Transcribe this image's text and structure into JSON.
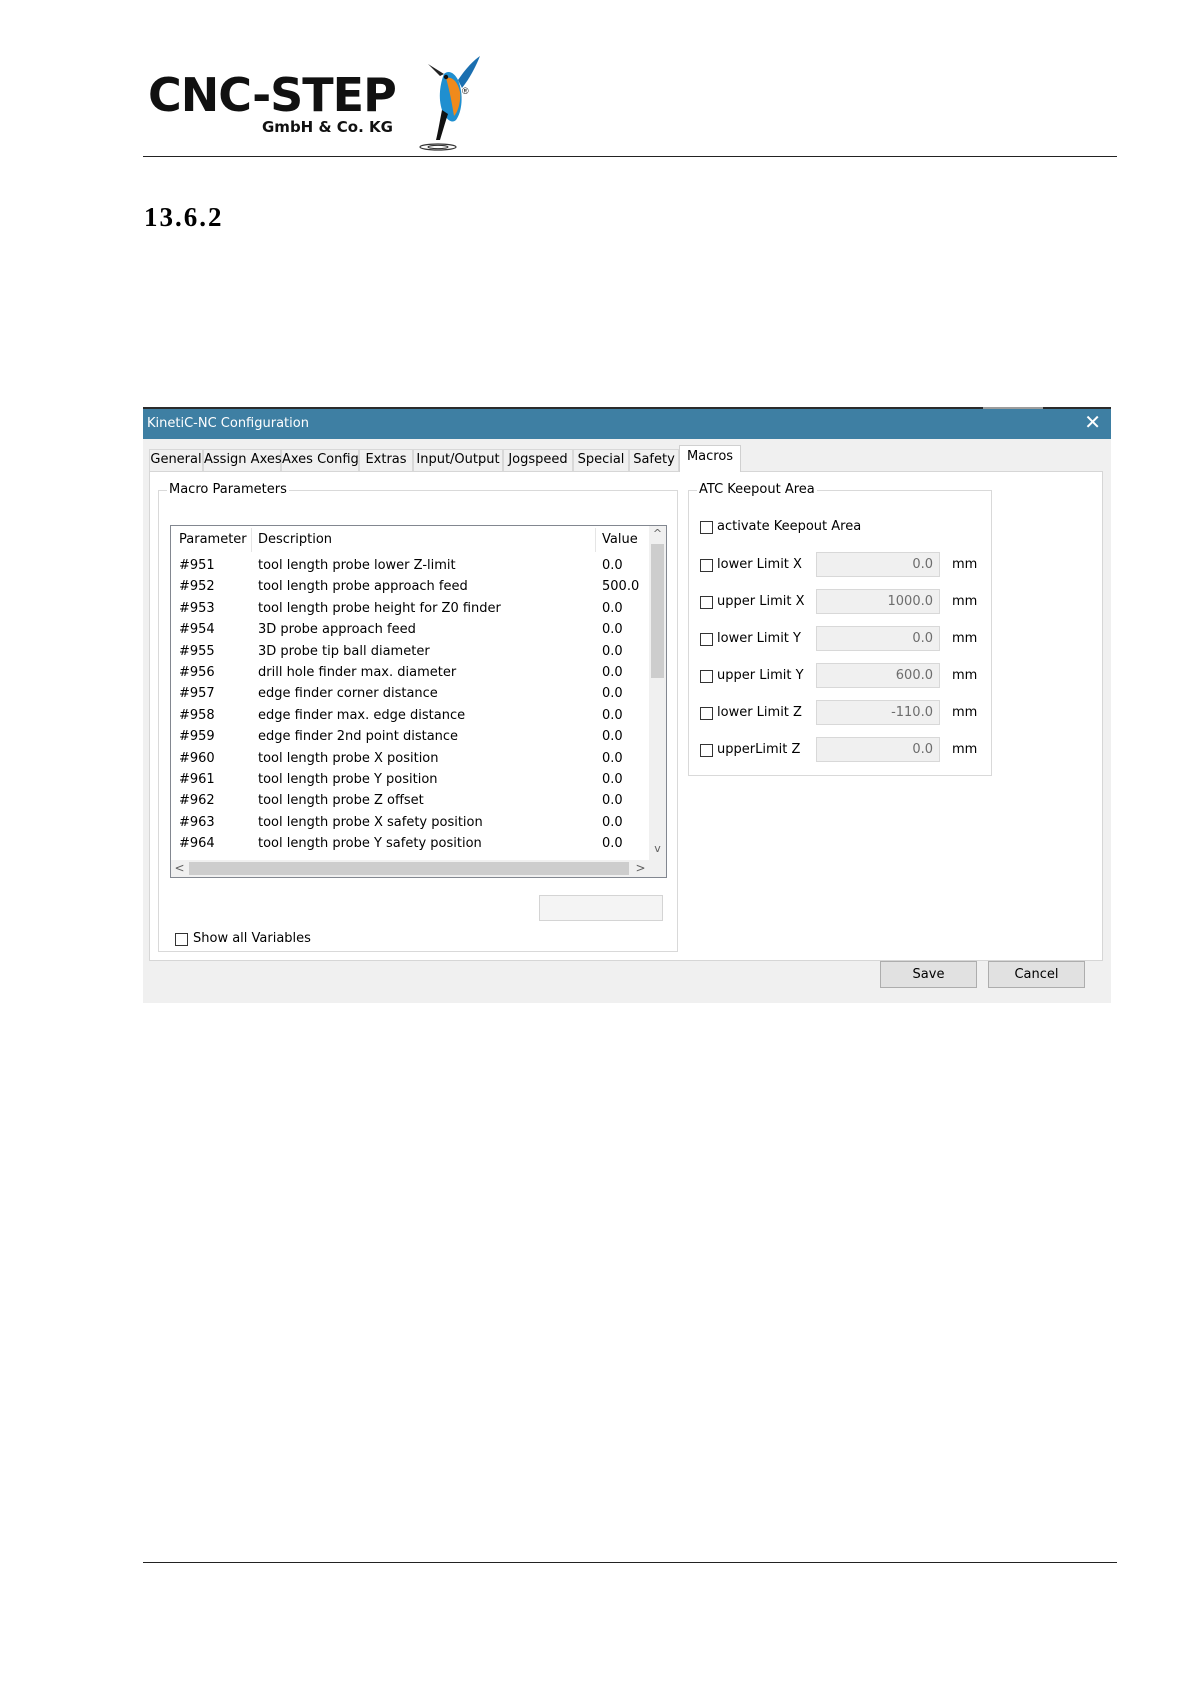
{
  "logo": {
    "name": "CNC-STEP",
    "registered": "®",
    "subtitle": "GmbH & Co. KG"
  },
  "section_number": "13.6.2",
  "dialog": {
    "title": "KinetiC-NC Configuration",
    "close_glyph": "✕",
    "tabs": [
      "General",
      "Assign Axes",
      "Axes Config",
      "Extras",
      "Input/Output",
      "Jogspeed",
      "Special",
      "Safety",
      "Macros"
    ],
    "active_tab": "Macros",
    "macro_parameters": {
      "legend": "Macro Parameters",
      "columns": [
        "Parameter",
        "Description",
        "Value"
      ],
      "rows": [
        [
          "#951",
          "tool length probe lower Z-limit",
          "0.0"
        ],
        [
          "#952",
          "tool length probe approach feed",
          "500.0"
        ],
        [
          "#953",
          "tool length probe height for Z0 finder",
          "0.0"
        ],
        [
          "#954",
          "3D probe approach feed",
          "0.0"
        ],
        [
          "#955",
          "3D probe tip ball diameter",
          "0.0"
        ],
        [
          "#956",
          "drill hole finder max. diameter",
          "0.0"
        ],
        [
          "#957",
          "edge finder corner distance",
          "0.0"
        ],
        [
          "#958",
          "edge finder max. edge distance",
          "0.0"
        ],
        [
          "#959",
          "edge finder 2nd point distance",
          "0.0"
        ],
        [
          "#960",
          "tool length probe X position",
          "0.0"
        ],
        [
          "#961",
          "tool length probe Y position",
          "0.0"
        ],
        [
          "#962",
          "tool length probe Z offset",
          "0.0"
        ],
        [
          "#963",
          "tool length probe X safety position",
          "0.0"
        ],
        [
          "#964",
          "tool length probe Y safety position",
          "0.0"
        ]
      ],
      "show_all_label": "Show all Variables",
      "show_all_checked": false
    },
    "atc_keepout": {
      "legend": "ATC Keepout Area",
      "activate_label": "activate Keepout Area",
      "activate_checked": false,
      "limits": [
        {
          "label": "lower Limit X",
          "value": "0.0",
          "unit": "mm",
          "checked": false
        },
        {
          "label": "upper Limit X",
          "value": "1000.0",
          "unit": "mm",
          "checked": false
        },
        {
          "label": "lower Limit Y",
          "value": "0.0",
          "unit": "mm",
          "checked": false
        },
        {
          "label": "upper Limit Y",
          "value": "600.0",
          "unit": "mm",
          "checked": false
        },
        {
          "label": "lower Limit Z",
          "value": "-110.0",
          "unit": "mm",
          "checked": false
        },
        {
          "label": "upperLimit Z",
          "value": "0.0",
          "unit": "mm",
          "checked": false
        }
      ]
    },
    "buttons": {
      "save": "Save",
      "cancel": "Cancel"
    },
    "scroll_glyphs": {
      "up": "^",
      "down": "v",
      "left": "<",
      "right": ">"
    }
  },
  "colors": {
    "titlebar": "#3e7fa3",
    "dialog_bg": "#f0f0f0",
    "bird_blue": "#1f8fd0",
    "bird_orange": "#f08a1c"
  }
}
